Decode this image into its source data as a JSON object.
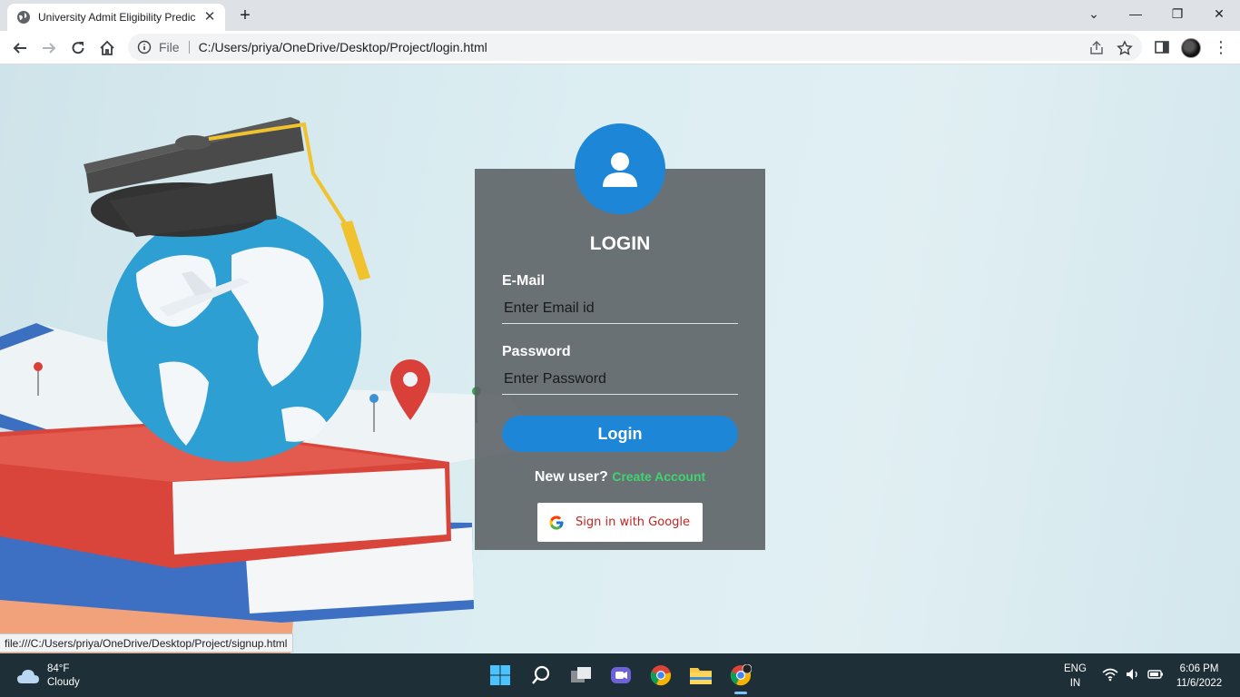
{
  "browser": {
    "tab_title": "University Admit Eligibility Predic",
    "file_label": "File",
    "url": "C:/Users/priya/OneDrive/Desktop/Project/login.html",
    "status_url": "file:///C:/Users/priya/OneDrive/Desktop/Project/signup.html"
  },
  "login": {
    "title": "LOGIN",
    "email_label": "E-Mail",
    "email_placeholder": "Enter Email id",
    "password_label": "Password",
    "password_placeholder": "Enter Password",
    "login_button": "Login",
    "new_user_label": "New user?",
    "create_account_link": "Create Account",
    "google_button": "Sign in with Google"
  },
  "colors": {
    "accent_blue": "#1e86d6",
    "link_green": "#3fd470",
    "card_bg": "#5a6063"
  },
  "taskbar": {
    "temperature": "84°F",
    "weather": "Cloudy",
    "lang_line1": "ENG",
    "lang_line2": "IN",
    "time": "6:06 PM",
    "date": "11/6/2022"
  }
}
